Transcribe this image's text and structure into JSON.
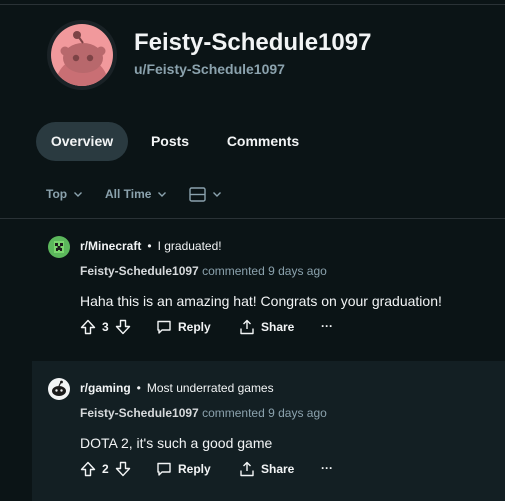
{
  "profile": {
    "display_name": "Feisty-Schedule1097",
    "username": "u/Feisty-Schedule1097"
  },
  "tabs": [
    {
      "label": "Overview",
      "active": true
    },
    {
      "label": "Posts",
      "active": false
    },
    {
      "label": "Comments",
      "active": false
    }
  ],
  "filters": {
    "sort": "Top",
    "time": "All Time"
  },
  "comments": [
    {
      "subreddit": "r/Minecraft",
      "post_title": "I graduated!",
      "author": "Feisty-Schedule1097",
      "meta": "commented 9 days ago",
      "text": "Haha this is an amazing hat! Congrats on your graduation!",
      "score": "3",
      "reply_label": "Reply",
      "share_label": "Share",
      "more_label": "···"
    },
    {
      "subreddit": "r/gaming",
      "post_title": "Most underrated games",
      "author": "Feisty-Schedule1097",
      "meta": "commented 9 days ago",
      "text": "DOTA 2, it's such a good game",
      "score": "2",
      "reply_label": "Reply",
      "share_label": "Share",
      "more_label": "···"
    }
  ],
  "colors": {
    "background": "#0b1416",
    "active_tab": "#2a3a40",
    "muted_text": "#8ba2ad",
    "avatar": "#f1999c",
    "minecraft_icon": "#5cb85c"
  }
}
